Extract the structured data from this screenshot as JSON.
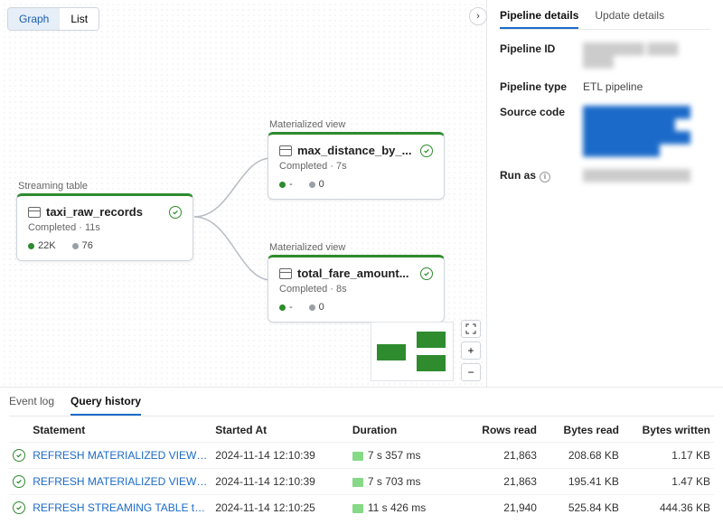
{
  "view_toggle": {
    "graph": "Graph",
    "list": "List"
  },
  "nodes": {
    "taxi": {
      "kind": "Streaming table",
      "name": "taxi_raw_records",
      "status": "Completed · 11s",
      "m1": "22K",
      "m2": "76"
    },
    "maxd": {
      "kind": "Materialized view",
      "name": "max_distance_by_...",
      "status": "Completed · 7s",
      "m1": "-",
      "m2": "0"
    },
    "fare": {
      "kind": "Materialized view",
      "name": "total_fare_amount...",
      "status": "Completed · 8s",
      "m1": "-",
      "m2": "0"
    }
  },
  "sidebar": {
    "tab1": "Pipeline details",
    "tab2": "Update details",
    "pipeline_id_k": "Pipeline ID",
    "pipeline_type_k": "Pipeline type",
    "pipeline_type_v": "ETL pipeline",
    "source_code_k": "Source code",
    "run_as_k": "Run as"
  },
  "bottom": {
    "tab1": "Event log",
    "tab2": "Query history",
    "cols": {
      "statement": "Statement",
      "started": "Started At",
      "duration": "Duration",
      "rows": "Rows read",
      "bytes_read": "Bytes read",
      "bytes_written": "Bytes written"
    },
    "rows": [
      {
        "s": "REFRESH MATERIALIZED VIEW max_di...",
        "t": "2024-11-14 12:10:39",
        "d": "7 s 357 ms",
        "r": "21,863",
        "br": "208.68 KB",
        "bw": "1.17 KB"
      },
      {
        "s": "REFRESH MATERIALIZED VIEW total_fa...",
        "t": "2024-11-14 12:10:39",
        "d": "7 s 703 ms",
        "r": "21,863",
        "br": "195.41 KB",
        "bw": "1.47 KB"
      },
      {
        "s": "REFRESH STREAMING TABLE taxi_raw...",
        "t": "2024-11-14 12:10:25",
        "d": "11 s 426 ms",
        "r": "21,940",
        "br": "525.84 KB",
        "bw": "444.36 KB"
      }
    ]
  }
}
